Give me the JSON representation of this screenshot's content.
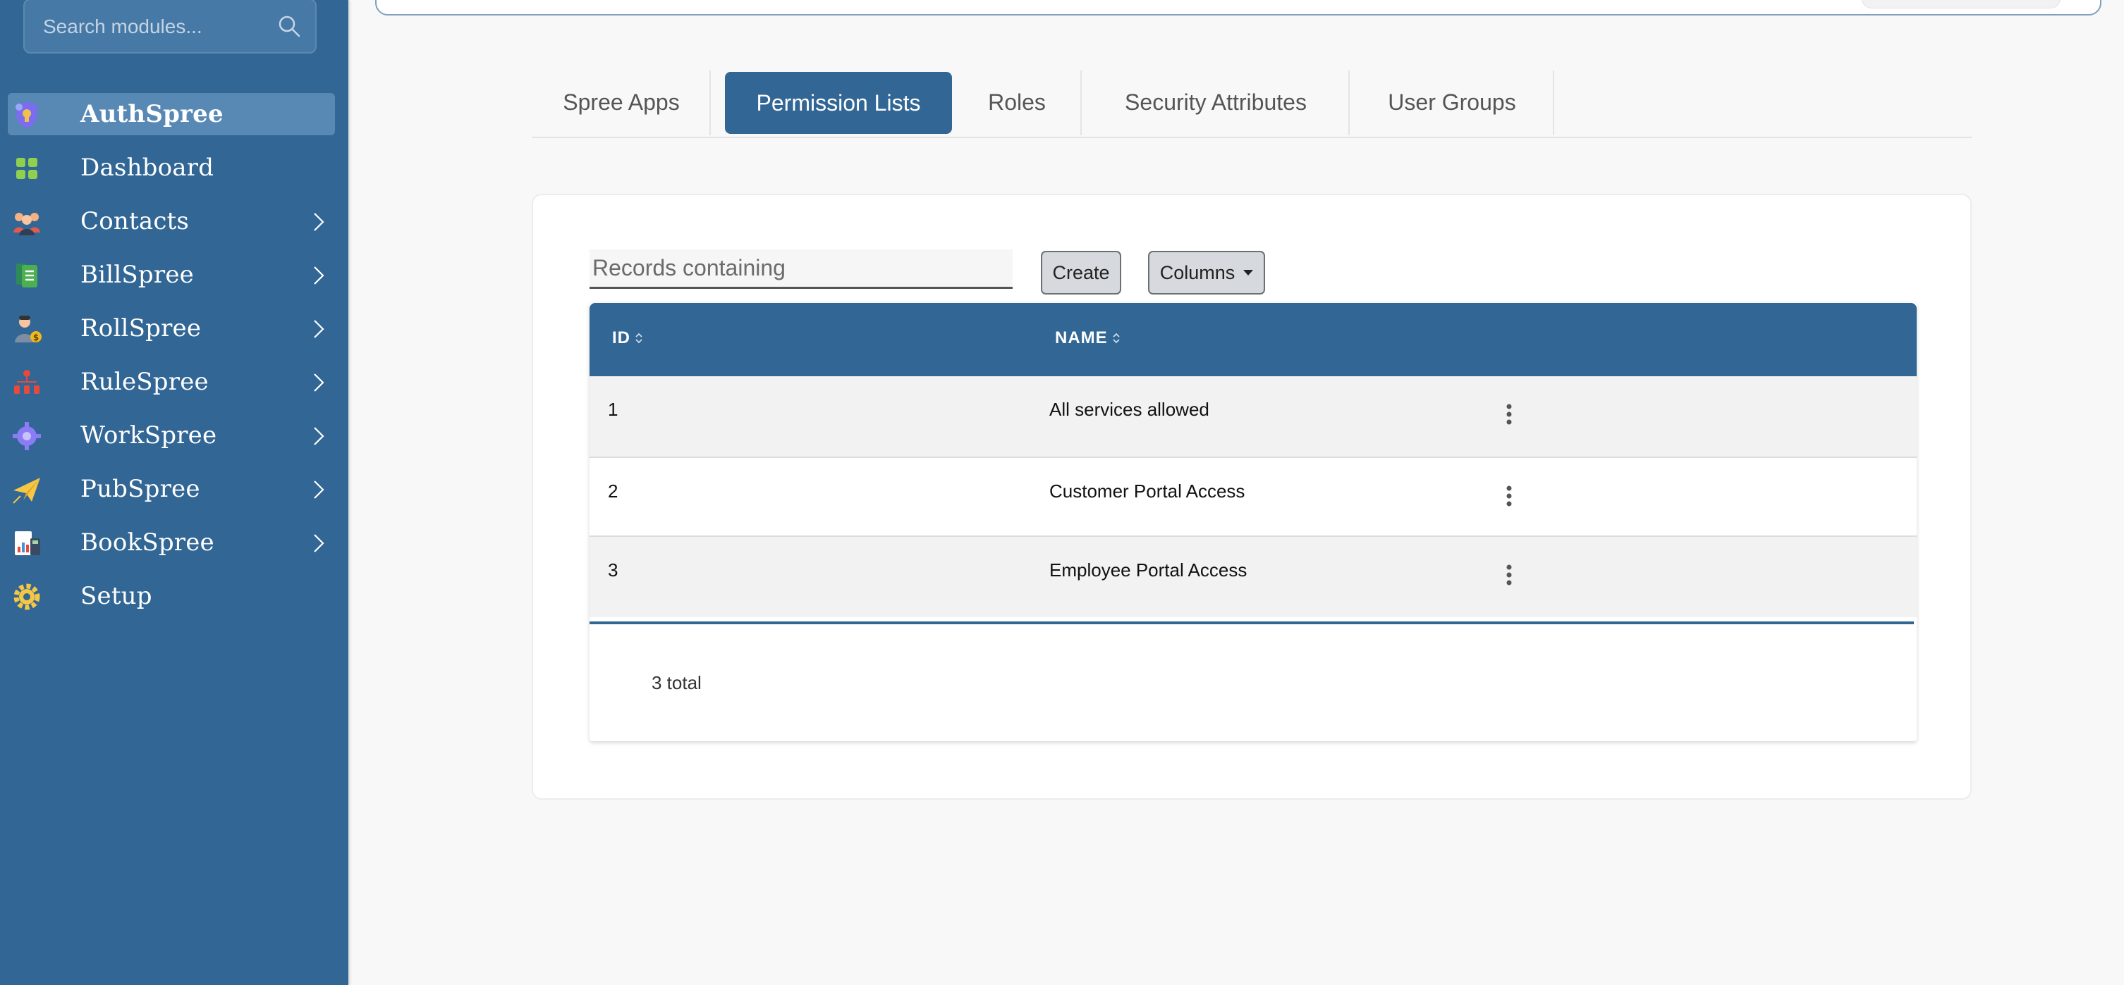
{
  "sidebar": {
    "search": {
      "placeholder": "Search modules...",
      "icon": "search-icon"
    },
    "items": [
      {
        "label": "AuthSpree",
        "icon": "shield-lock-icon",
        "active": true,
        "has_children": false
      },
      {
        "label": "Dashboard",
        "icon": "dashboard-grid-icon",
        "active": false,
        "has_children": false
      },
      {
        "label": "Contacts",
        "icon": "people-group-icon",
        "active": false,
        "has_children": true
      },
      {
        "label": "BillSpree",
        "icon": "invoice-document-icon",
        "active": false,
        "has_children": true
      },
      {
        "label": "RollSpree",
        "icon": "worker-payroll-icon",
        "active": false,
        "has_children": true
      },
      {
        "label": "RuleSpree",
        "icon": "hierarchy-rules-icon",
        "active": false,
        "has_children": true
      },
      {
        "label": "WorkSpree",
        "icon": "workflow-gear-icon",
        "active": false,
        "has_children": true
      },
      {
        "label": "PubSpree",
        "icon": "paper-plane-icon",
        "active": false,
        "has_children": true
      },
      {
        "label": "BookSpree",
        "icon": "ledger-calculator-icon",
        "active": false,
        "has_children": true
      },
      {
        "label": "Setup",
        "icon": "gear-icon",
        "active": false,
        "has_children": false
      }
    ]
  },
  "tabs": [
    {
      "label": "Spree Apps",
      "active": false
    },
    {
      "label": "Permission Lists",
      "active": true
    },
    {
      "label": "Roles",
      "active": false
    },
    {
      "label": "Security Attributes",
      "active": false
    },
    {
      "label": "User Groups",
      "active": false
    }
  ],
  "toolbar": {
    "filter_placeholder": "Records containing",
    "create_label": "Create",
    "columns_label": "Columns"
  },
  "table": {
    "columns": [
      "ID",
      "NAME"
    ],
    "rows": [
      {
        "id": "1",
        "name": "All services allowed"
      },
      {
        "id": "2",
        "name": "Customer Portal Access"
      },
      {
        "id": "3",
        "name": "Employee Portal Access"
      }
    ],
    "total": "3 total"
  },
  "colors": {
    "sidebar": "#316695",
    "accent": "#316695",
    "active_nav": "#5889b5",
    "background": "#f8f8f8"
  }
}
